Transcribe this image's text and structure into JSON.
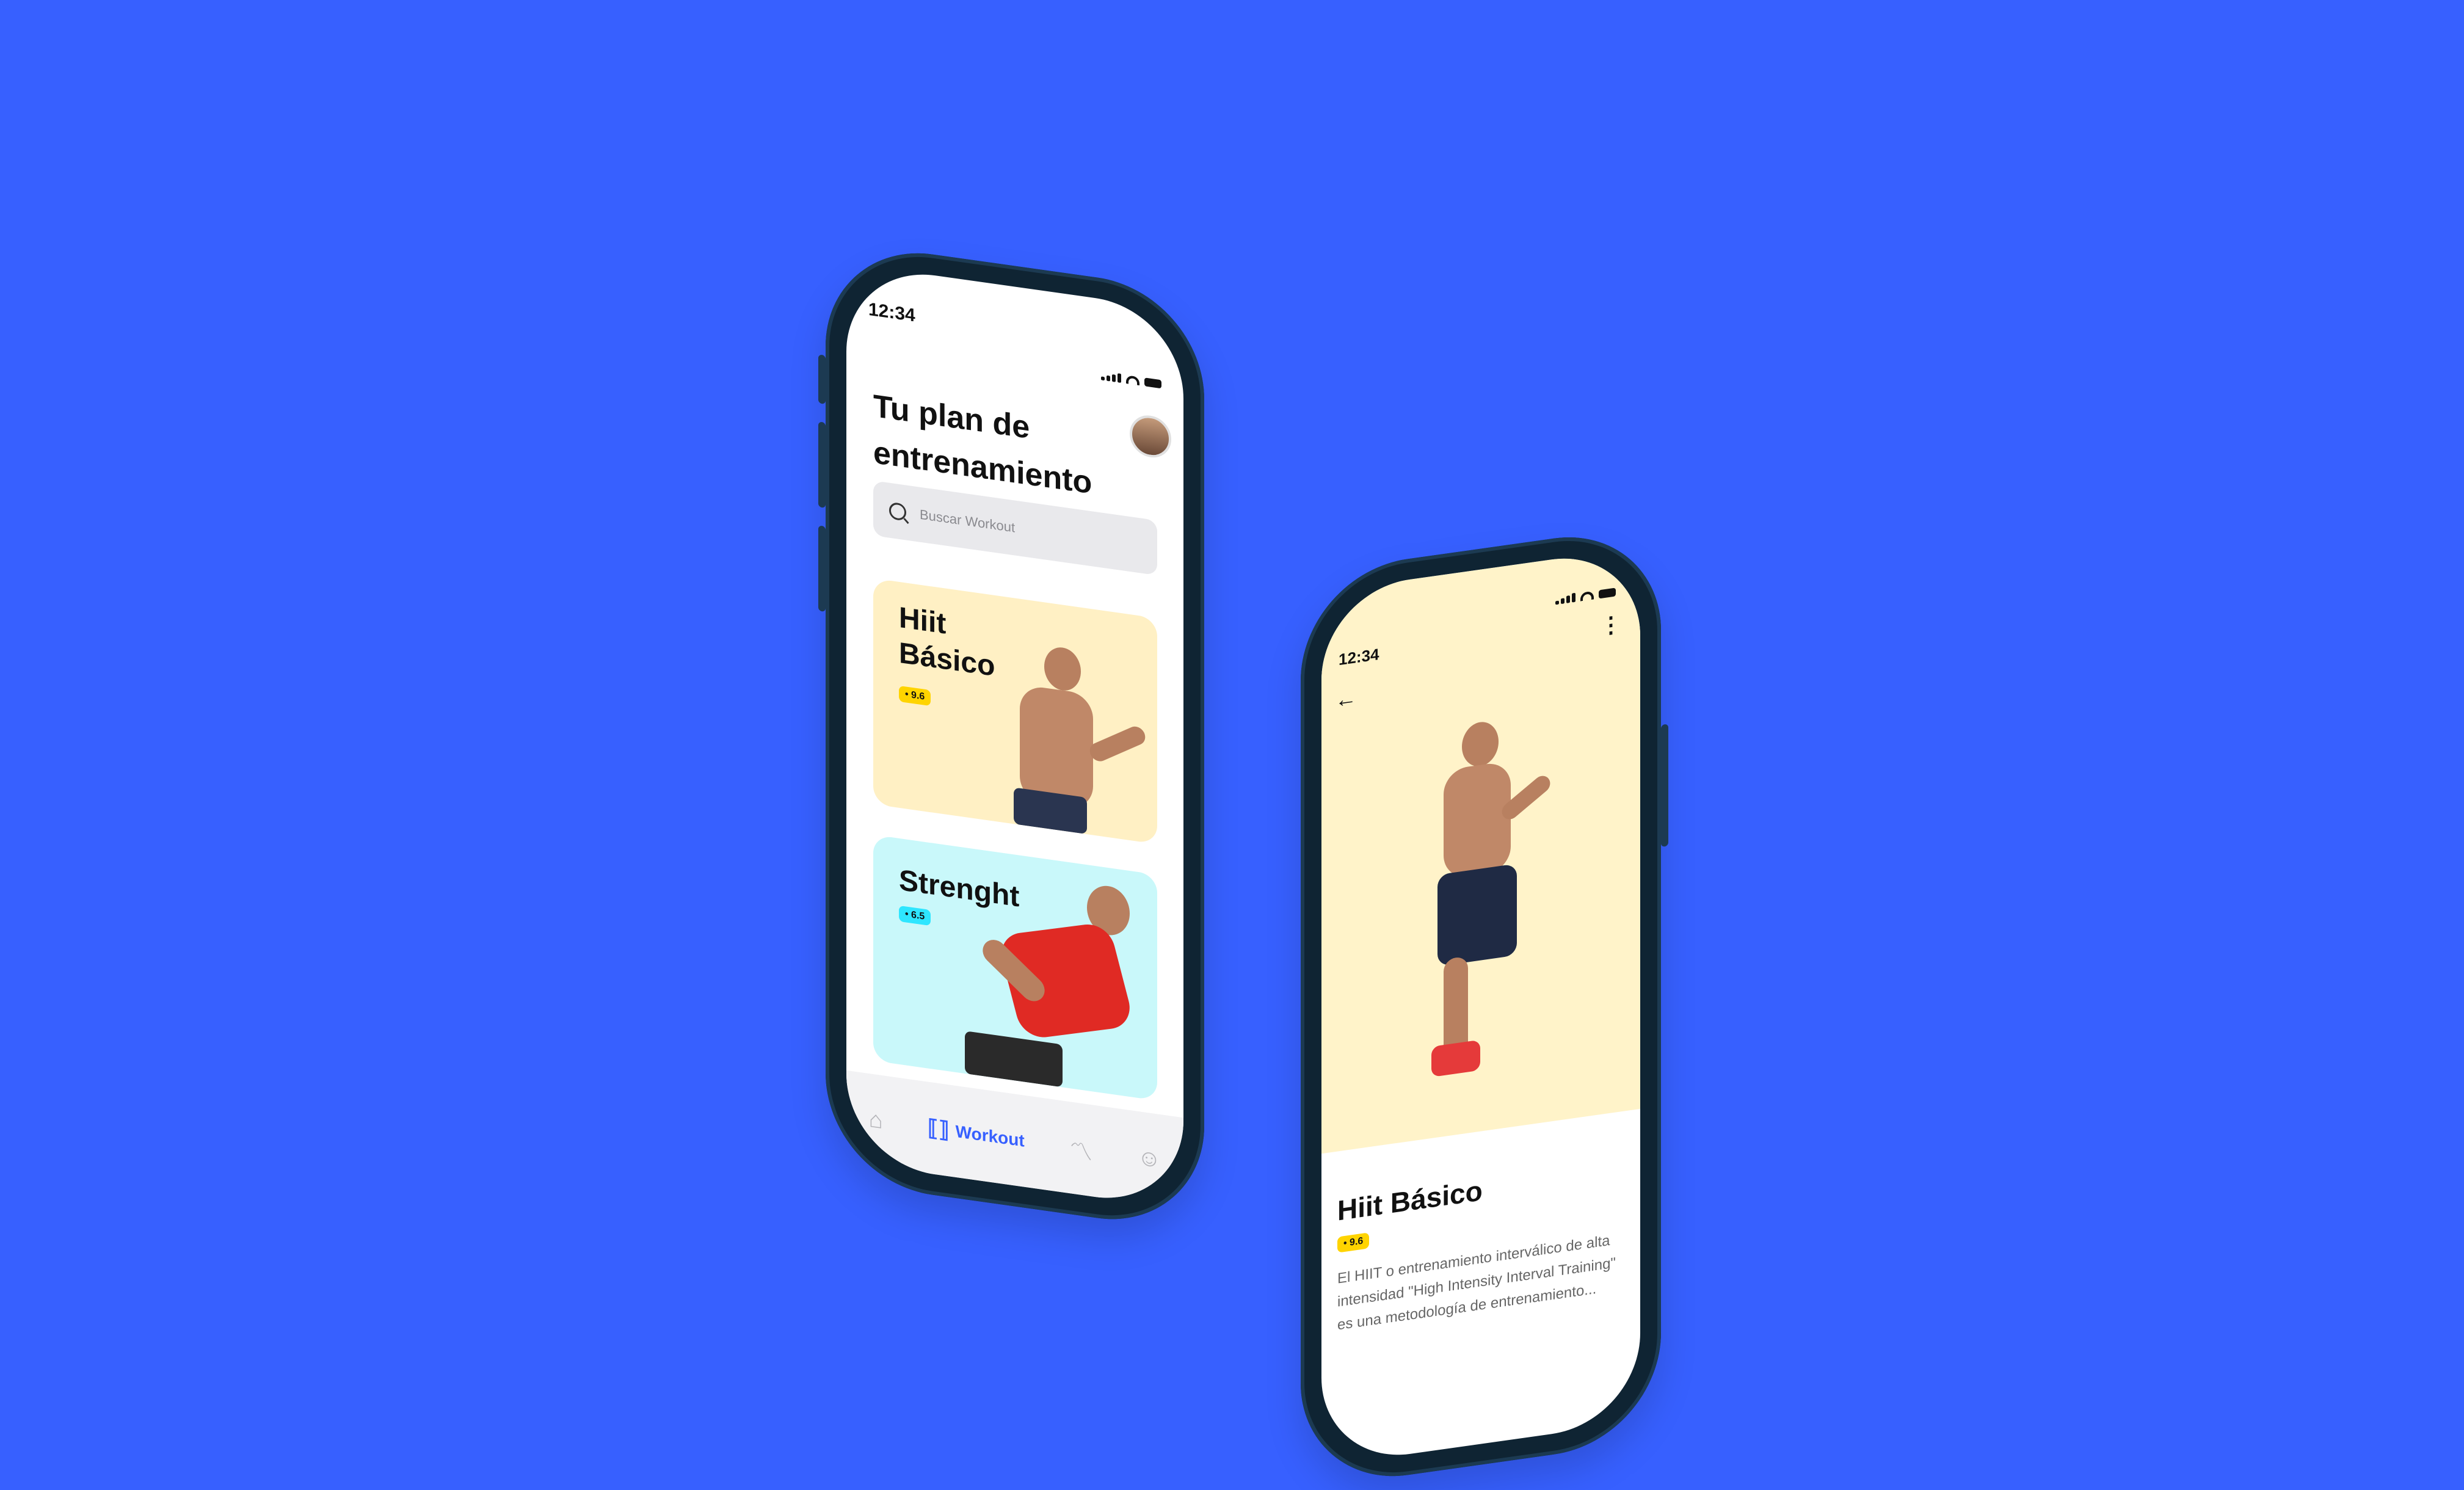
{
  "screen_home": {
    "time": "12:34",
    "title_line1": "Tu plan de",
    "title_line2": "entrenamiento",
    "search": {
      "placeholder": "Buscar Workout"
    },
    "cards": [
      {
        "title_line1": "Hiit",
        "title_line2": "Básico",
        "rating": "• 9.6",
        "bg": "#fff0c4",
        "badge_color": "#ffd400"
      },
      {
        "title_line1": "Strenght",
        "title_line2": "",
        "rating": "• 6.5",
        "bg": "#c9f8fa",
        "badge_color": "#2ee6ff"
      }
    ],
    "tabbar": {
      "items": [
        "home-icon",
        "workout-icon",
        "stats-icon",
        "profile-icon"
      ],
      "active_label": "Workout"
    }
  },
  "screen_detail": {
    "time": "12:34",
    "title": "Hiit Básico",
    "rating": "• 9.6",
    "badge_color": "#ffd400",
    "description": "El HIIT o entrenamiento interválico de alta intensidad \"High Intensity Interval Training\" es una metodología de entrenamiento..."
  },
  "colors": {
    "background": "#3760ff",
    "accent": "#3760ff",
    "phone_frame": "#0f2433"
  }
}
